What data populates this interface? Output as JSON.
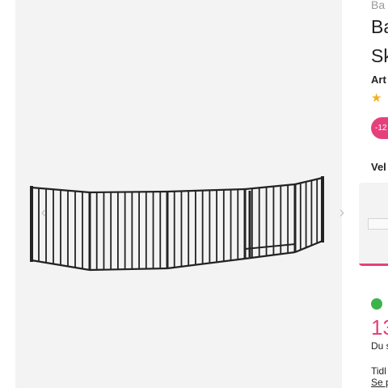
{
  "gallery": {
    "prev_icon": "chevron-left-icon",
    "next_icon": "chevron-right-icon",
    "prev_glyph": "‹",
    "next_glyph": "›",
    "image_color": "#232323",
    "background": "#f3f3f3"
  },
  "product": {
    "brand": "Ba",
    "title_line1": "Ba",
    "title_line2": "Sk",
    "article_label": "Art",
    "rating_icon": "star-icon",
    "rating_glyph": "★",
    "discount_badge": "-12",
    "variant_label": "Vel",
    "stock_icon": "in-stock-dot-icon",
    "price": "13",
    "saved_text": "Du s",
    "earlier_text": "Tidl",
    "see_link": "Se p"
  },
  "colors": {
    "accent": "#e6407c",
    "stock": "#3cb34a",
    "star": "#f2b01e"
  }
}
